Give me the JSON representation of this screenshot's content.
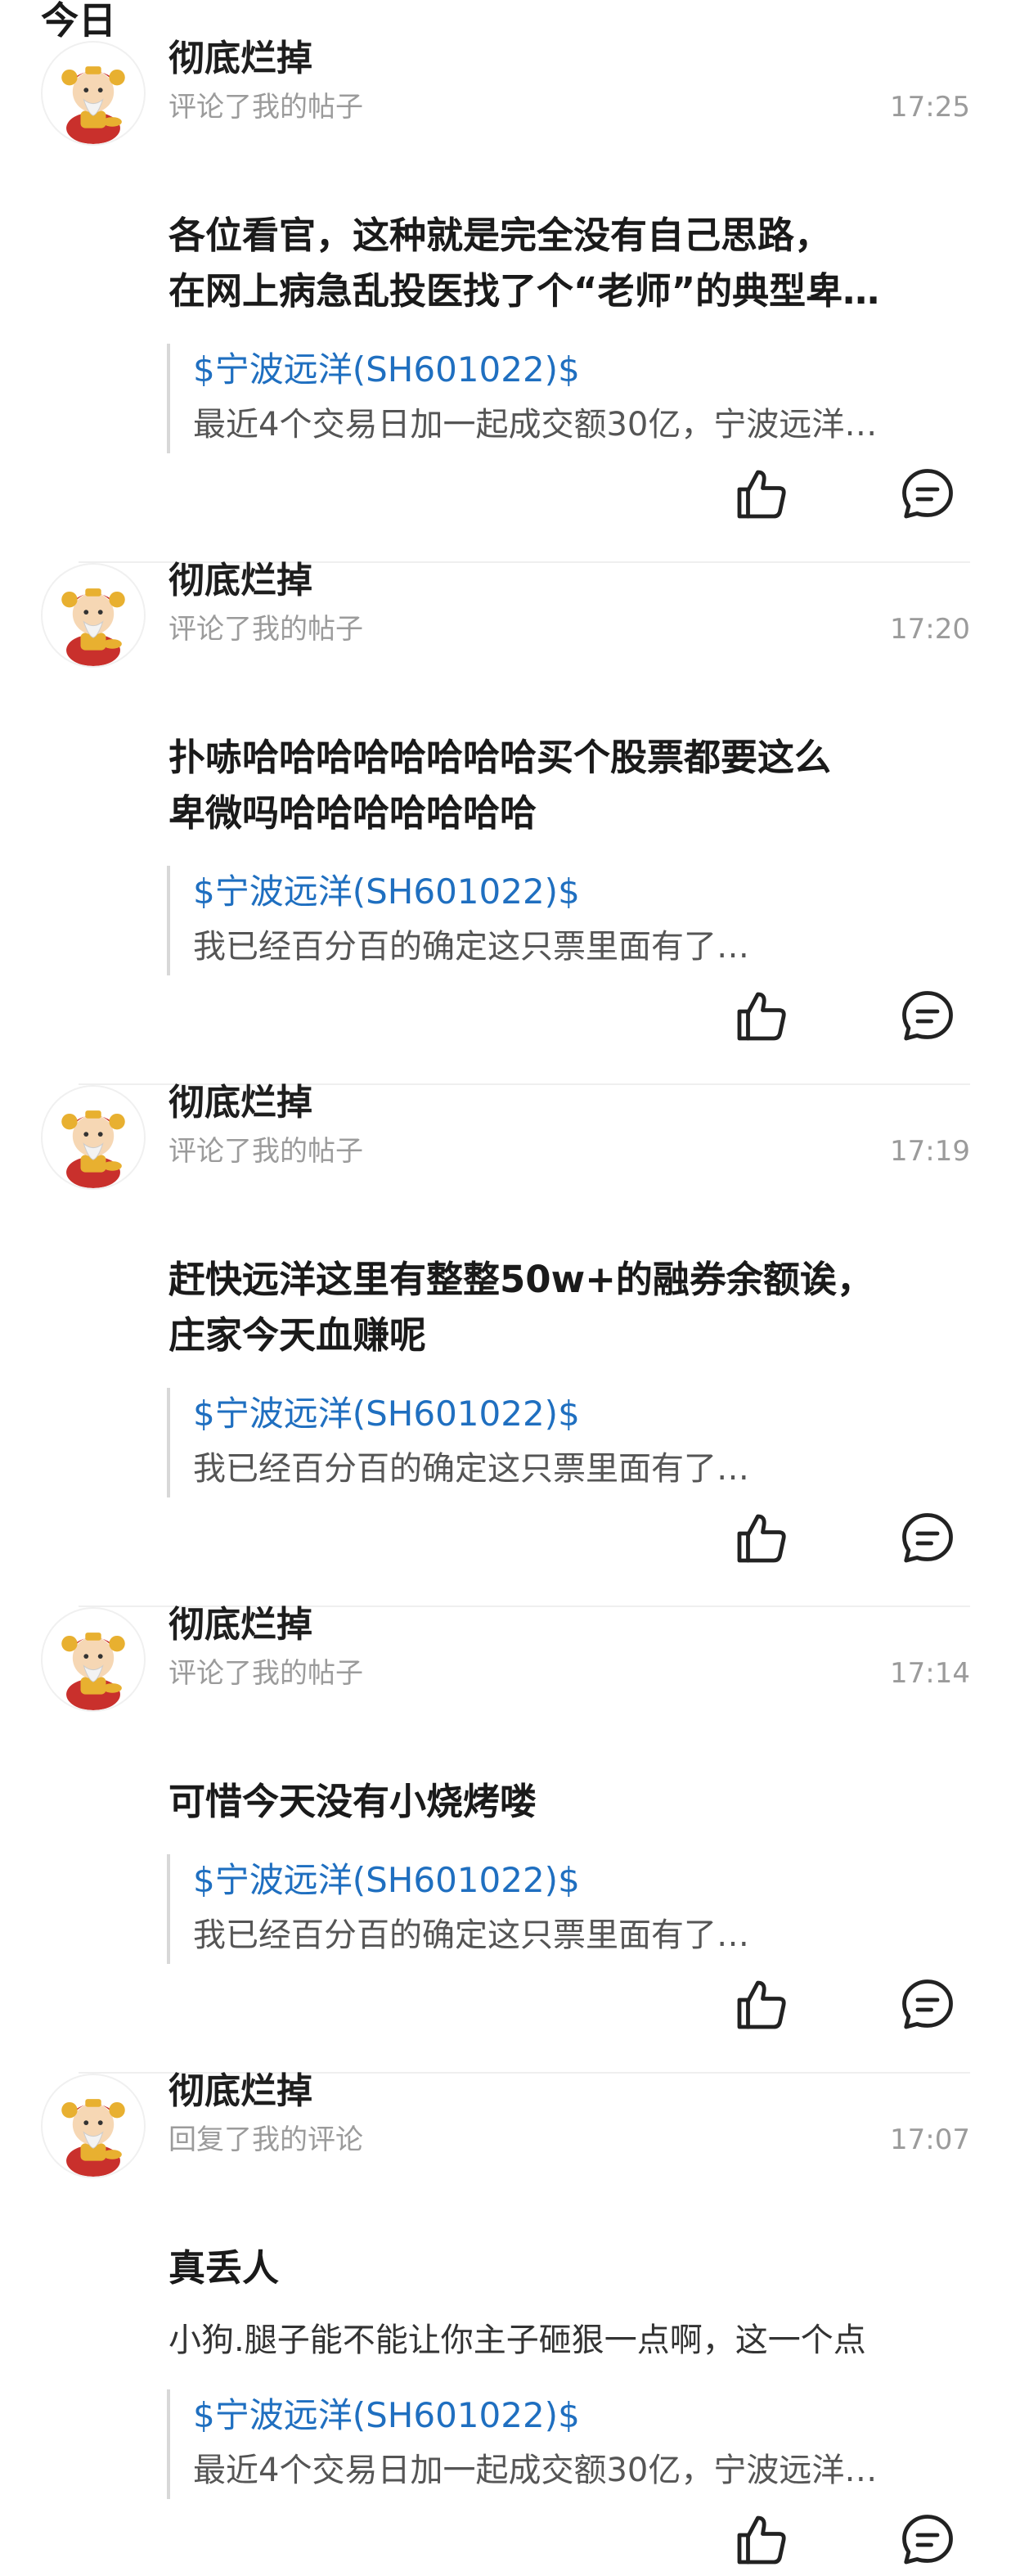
{
  "section_title": "今日",
  "notifications": [
    {
      "username": "彻底烂掉",
      "action": "评论了我的帖子",
      "time": "17:25",
      "content_lines": [
        "各位看官，这种就是完全没有自己思路，",
        "在网上病急乱投医找了个“老师”的典型卑…"
      ],
      "quote_title": "$宁波远洋(SH601022)$",
      "quote_text": "最近4个交易日加一起成交额30亿，宁波远洋…"
    },
    {
      "username": "彻底烂掉",
      "action": "评论了我的帖子",
      "time": "17:20",
      "content_lines": [
        "扑哧哈哈哈哈哈哈哈哈买个股票都要这么",
        "卑微吗哈哈哈哈哈哈哈"
      ],
      "quote_title": "$宁波远洋(SH601022)$",
      "quote_text": "我已经百分百的确定这只票里面有了…"
    },
    {
      "username": "彻底烂掉",
      "action": "评论了我的帖子",
      "time": "17:19",
      "content_lines": [
        "赶快远洋这里有整整50w+的融券余额诶，",
        "庄家今天血赚呢"
      ],
      "quote_title": "$宁波远洋(SH601022)$",
      "quote_text": "我已经百分百的确定这只票里面有了…"
    },
    {
      "username": "彻底烂掉",
      "action": "评论了我的帖子",
      "time": "17:14",
      "content_lines": [
        "可惜今天没有小烧烤喽"
      ],
      "quote_title": "$宁波远洋(SH601022)$",
      "quote_text": "我已经百分百的确定这只票里面有了…"
    },
    {
      "username": "彻底烂掉",
      "action": "回复了我的评论",
      "time": "17:07",
      "content_lines": [
        "真丢人"
      ],
      "reply_text": "小狗.腿子能不能让你主子砸狠一点啊，这一个点",
      "quote_title": "$宁波远洋(SH601022)$",
      "quote_text": "最近4个交易日加一起成交额30亿，宁波远洋…"
    }
  ],
  "icons": {
    "like": "thumbs-up-icon",
    "comment": "comment-bubble-icon",
    "avatar": "fortune-god-avatar"
  },
  "colors": {
    "link": "#1f6fc0",
    "meta": "#9b9b9b",
    "quote_bar": "#d8d8d8"
  }
}
